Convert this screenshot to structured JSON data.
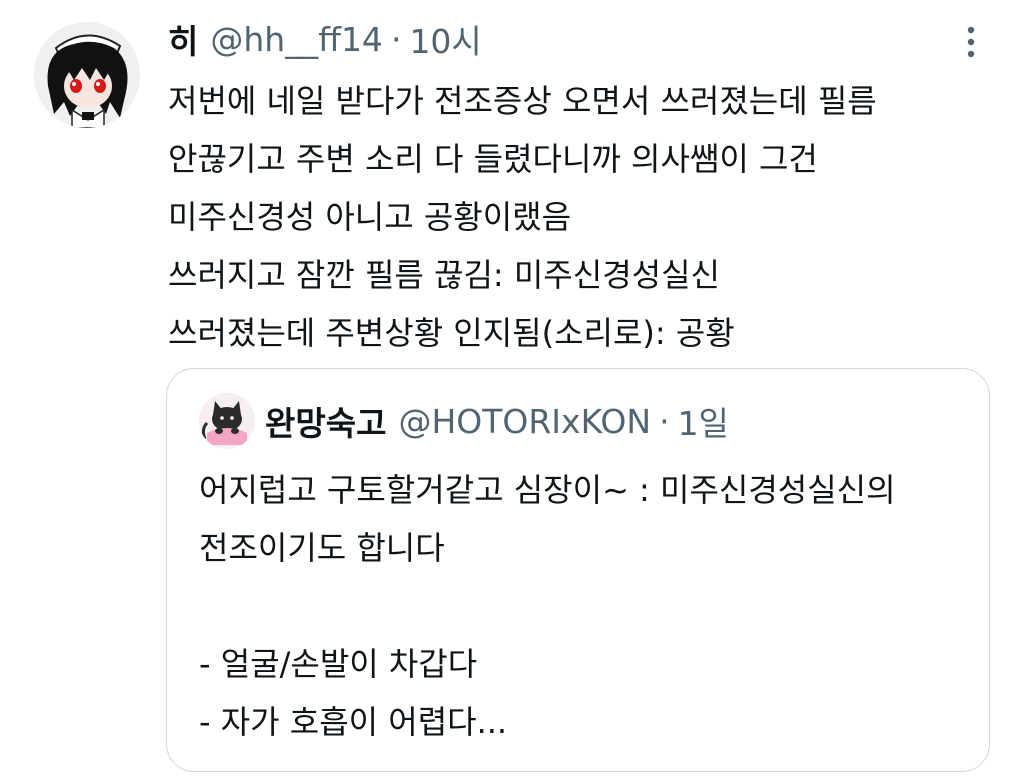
{
  "tweet": {
    "author_name": "히",
    "author_handle": "@hh__ff14",
    "separator": "·",
    "time": "10시",
    "body_lines": [
      "저번에 네일 받다가 전조증상 오면서 쓰러졌는데 필름",
      "안끊기고 주변 소리 다 들렸다니까 의사쌤이 그건",
      "미주신경성 아니고 공황이랬음",
      "쓰러지고 잠깐 필름 끊김: 미주신경성실신",
      "쓰러졌는데 주변상황 인지됨(소리로): 공황"
    ],
    "more_icon": "more-vertical-icon"
  },
  "quote": {
    "author_name": "완망숙고",
    "author_handle": "@HOTORIxKON",
    "separator": "·",
    "time": "1일",
    "body_lines": [
      "어지럽고 구토할거같고 심장이~ : 미주신경성실신의",
      "전조이기도 합니다",
      "",
      "- 얼굴/손발이 차갑다",
      "- 자가 호흡이 어렵다..."
    ]
  },
  "colors": {
    "text": "#0f1419",
    "secondary": "#536471",
    "border": "#cfd9de"
  }
}
